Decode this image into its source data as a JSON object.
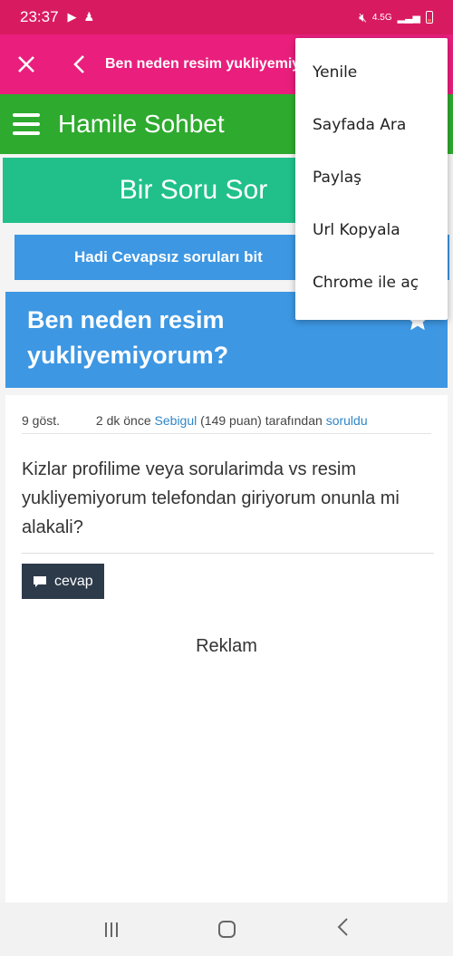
{
  "status_bar": {
    "time": "23:37",
    "network": "4.5G"
  },
  "toolbar": {
    "title": "Ben neden resim yukliyemiyo"
  },
  "site": {
    "title": "Hamile Sohbet",
    "ask_label": "Bir Soru Sor",
    "unanswered_label": "Hadi Cevapsız soruları bit"
  },
  "question": {
    "title": "Ben neden resim yukliyemiyorum?",
    "views": "9 göst.",
    "time_ago": "2 dk önce",
    "author": "Sebigul",
    "points": "(149 puan)",
    "by_text": "tarafından",
    "asked_link": "soruldu",
    "body": "Kizlar profilime veya sorularimda vs resim yukliyemiyorum telefondan giriyorum onunla mi alakali?",
    "answer_label": "cevap"
  },
  "ad_label": "Reklam",
  "menu": {
    "items": [
      {
        "label": "Yenile"
      },
      {
        "label": "Sayfada Ara"
      },
      {
        "label": "Paylaş"
      },
      {
        "label": "Url Kopyala"
      },
      {
        "label": "Chrome ile aç"
      }
    ]
  },
  "colors": {
    "status_bar": "#d81b60",
    "toolbar": "#e91e7d",
    "site_header": "#2eaa2e",
    "ask_button": "#21c08b",
    "blue": "#3d97e3",
    "answer_button": "#2d3a4a"
  }
}
